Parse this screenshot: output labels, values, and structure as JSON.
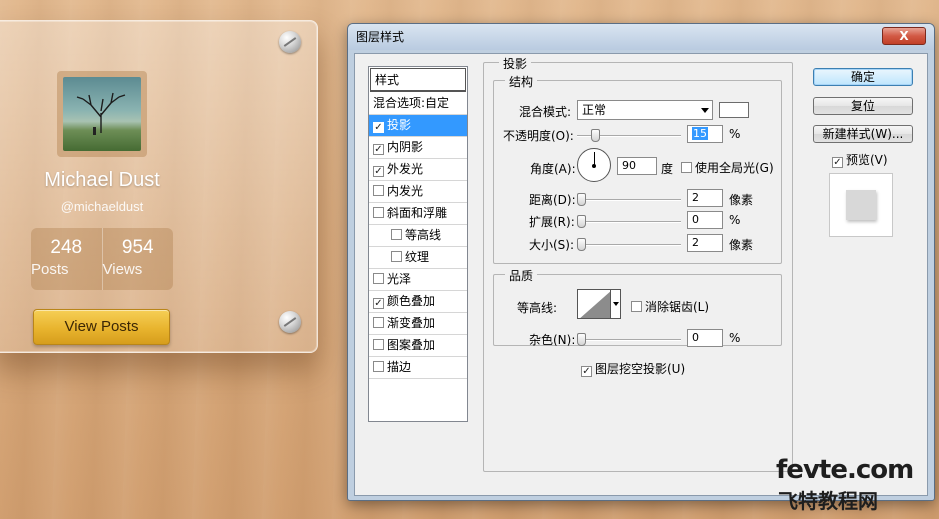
{
  "profile_card": {
    "name": "Michael Dust",
    "handle": "@michaeldust",
    "stats": [
      {
        "value": "248",
        "label": "Posts"
      },
      {
        "value": "954",
        "label": "Views"
      }
    ],
    "button_label": "View Posts"
  },
  "dialog": {
    "title": "图层样式",
    "close_label": "X",
    "styles_header": "样式",
    "styles": [
      {
        "label": "混合选项:自定",
        "checkbox": false,
        "checked": false,
        "selected": false,
        "sub": false
      },
      {
        "label": "投影",
        "checkbox": true,
        "checked": true,
        "selected": true,
        "sub": false
      },
      {
        "label": "内阴影",
        "checkbox": true,
        "checked": true,
        "selected": false,
        "sub": false
      },
      {
        "label": "外发光",
        "checkbox": true,
        "checked": true,
        "selected": false,
        "sub": false
      },
      {
        "label": "内发光",
        "checkbox": true,
        "checked": false,
        "selected": false,
        "sub": false
      },
      {
        "label": "斜面和浮雕",
        "checkbox": true,
        "checked": false,
        "selected": false,
        "sub": false
      },
      {
        "label": "等高线",
        "checkbox": true,
        "checked": false,
        "selected": false,
        "sub": true
      },
      {
        "label": "纹理",
        "checkbox": true,
        "checked": false,
        "selected": false,
        "sub": true
      },
      {
        "label": "光泽",
        "checkbox": true,
        "checked": false,
        "selected": false,
        "sub": false
      },
      {
        "label": "颜色叠加",
        "checkbox": true,
        "checked": true,
        "selected": false,
        "sub": false
      },
      {
        "label": "渐变叠加",
        "checkbox": true,
        "checked": false,
        "selected": false,
        "sub": false
      },
      {
        "label": "图案叠加",
        "checkbox": true,
        "checked": false,
        "selected": false,
        "sub": false
      },
      {
        "label": "描边",
        "checkbox": true,
        "checked": false,
        "selected": false,
        "sub": false
      }
    ],
    "drop_shadow": {
      "section_title": "投影",
      "structure_title": "结构",
      "blend_mode_label": "混合模式:",
      "blend_mode_value": "正常",
      "blend_color": "#ffffff",
      "opacity_label": "不透明度(O):",
      "opacity_value": "15",
      "opacity_unit": "%",
      "opacity_fraction": 0.15,
      "angle_label": "角度(A):",
      "angle_value": "90",
      "angle_unit": "度",
      "global_light_label": "使用全局光(G)",
      "global_light_checked": false,
      "distance_label": "距离(D):",
      "distance_value": "2",
      "distance_unit": "像素",
      "spread_label": "扩展(R):",
      "spread_value": "0",
      "spread_unit": "%",
      "size_label": "大小(S):",
      "size_value": "2",
      "size_unit": "像素",
      "quality_title": "品质",
      "contour_label": "等高线:",
      "antialias_label": "消除锯齿(L)",
      "antialias_checked": false,
      "noise_label": "杂色(N):",
      "noise_value": "0",
      "noise_unit": "%",
      "knockout_label": "图层挖空投影(U)",
      "knockout_checked": true
    },
    "buttons": {
      "ok": "确定",
      "reset": "复位",
      "new_style": "新建样式(W)...",
      "preview_label": "预览(V)",
      "preview_checked": true
    }
  },
  "watermark": {
    "line1": "fevte.com",
    "line2": "飞特教程网"
  }
}
